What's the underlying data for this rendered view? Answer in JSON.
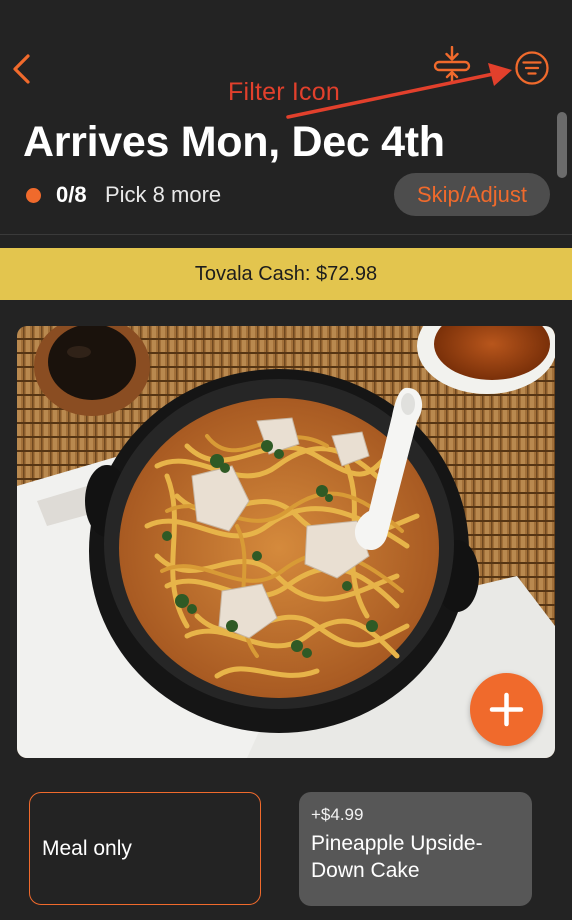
{
  "header": {
    "back_icon": "chevron-left-icon",
    "import_icon": "import-icon",
    "filter_icon": "filter-icon",
    "annotation": "Filter Icon",
    "annotation_color": "#e2402c"
  },
  "delivery": {
    "title": "Arrives Mon, Dec 4th",
    "count": "0/8",
    "pick_more": "Pick 8 more",
    "skip_label": "Skip/Adjust"
  },
  "banner": {
    "text": "Tovala Cash: $72.98"
  },
  "meal": {
    "image_icon": "noodle-bowl-photo",
    "add_icon": "plus-icon"
  },
  "options": [
    {
      "label": "Meal only"
    },
    {
      "price": "+$4.99",
      "label": "Pineapple Upside-Down Cake"
    }
  ],
  "colors": {
    "background": "#232323",
    "accent": "#f06a2c",
    "banner": "#e3c54e",
    "secondary_button": "#4d4d4d",
    "addon_card": "#575757"
  }
}
